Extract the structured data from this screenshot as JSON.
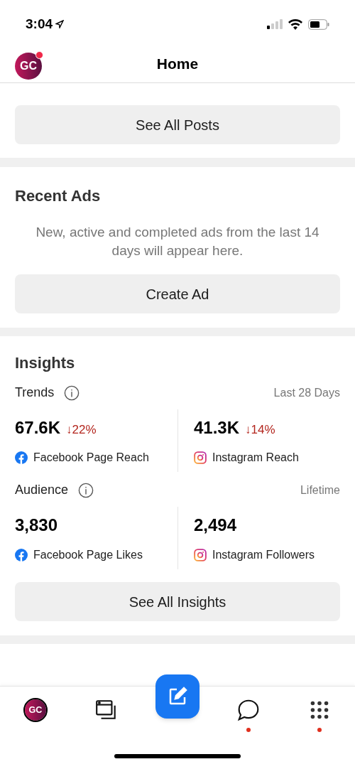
{
  "status_bar": {
    "time": "3:04"
  },
  "header": {
    "title": "Home",
    "logo_text": "GC",
    "notification_dot": true
  },
  "posts": {
    "button": "See All Posts"
  },
  "recent_ads": {
    "title": "Recent Ads",
    "description": "New, active and completed ads from the last 14 days will appear here.",
    "button": "Create Ad"
  },
  "insights": {
    "title": "Insights",
    "groups": [
      {
        "title": "Trends",
        "period": "Last 28 Days",
        "metrics": [
          {
            "value": "67.6K",
            "change": "↓22%",
            "label": "Facebook Page Reach",
            "kind": "facebook"
          },
          {
            "value": "41.3K",
            "change": "↓14%",
            "label": "Instagram Reach",
            "kind": "instagram"
          }
        ]
      },
      {
        "title": "Audience",
        "period": "Lifetime",
        "metrics": [
          {
            "value": "3,830",
            "label": "Facebook Page Likes",
            "kind": "facebook"
          },
          {
            "value": "2,494",
            "label": "Instagram Followers",
            "kind": "instagram"
          }
        ]
      }
    ],
    "button": "See All Insights"
  },
  "nav": [
    {
      "kind": "profile",
      "dot": false,
      "logo_text": "GC"
    },
    {
      "kind": "pages",
      "dot": false
    },
    {
      "kind": "compose",
      "dot": false
    },
    {
      "kind": "chat",
      "dot": true
    },
    {
      "kind": "menu",
      "dot": true
    }
  ]
}
